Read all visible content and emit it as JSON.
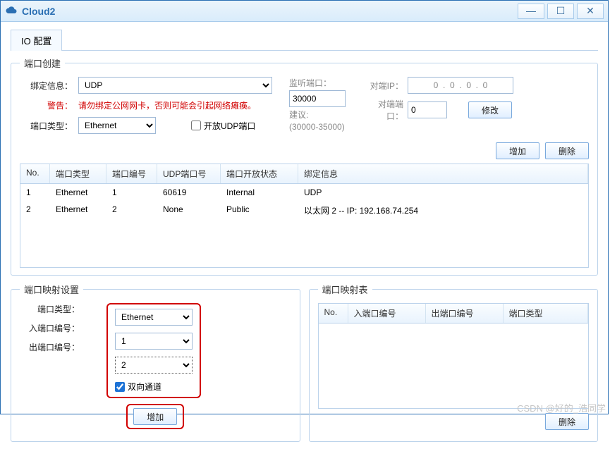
{
  "window": {
    "title": "Cloud2"
  },
  "winbtns": {
    "min": "—",
    "max": "☐",
    "close": "✕"
  },
  "tab": {
    "label": "IO 配置"
  },
  "portCreate": {
    "legend": "端口创建",
    "bindLabel": "绑定信息：",
    "bindValue": "UDP",
    "warnLabel": "警告：",
    "warnText": "请勿绑定公网网卡，否则可能会引起网络瘫痪。",
    "typeLabel": "端口类型：",
    "typeValue": "Ethernet",
    "openUdp": "开放UDP端口",
    "listenLabel": "监听端口：",
    "listenValue": "30000",
    "adviceLabel": "建议:",
    "adviceText": "(30000-35000)",
    "peerIpLabel": "对端IP：",
    "peerIpValue": "0  .  0  .  0  .  0",
    "peerPortLabel": "对端端口：",
    "peerPortValue": "0",
    "modify": "修改",
    "add": "增加",
    "del": "删除"
  },
  "table": {
    "h1": "No.",
    "h2": "端口类型",
    "h3": "端口编号",
    "h4": "UDP端口号",
    "h5": "端口开放状态",
    "h6": "绑定信息",
    "rows": [
      {
        "no": "1",
        "type": "Ethernet",
        "num": "1",
        "udp": "60619",
        "state": "Internal",
        "bind": "UDP"
      },
      {
        "no": "2",
        "type": "Ethernet",
        "num": "2",
        "udp": "None",
        "state": "Public",
        "bind": "以太网 2 -- IP: 192.168.74.254"
      }
    ]
  },
  "mapCfg": {
    "legend": "端口映射设置",
    "typeLabel": "端口类型：",
    "typeValue": "Ethernet",
    "inLabel": "入端口编号：",
    "inValue": "1",
    "outLabel": "出端口编号：",
    "outValue": "2",
    "dual": "双向通道",
    "add": "增加"
  },
  "mapTable": {
    "legend": "端口映射表",
    "h1": "No.",
    "h2": "入端口编号",
    "h3": "出端口编号",
    "h4": "端口类型",
    "del": "删除"
  },
  "watermark": "CSDN @好的_浩同学"
}
